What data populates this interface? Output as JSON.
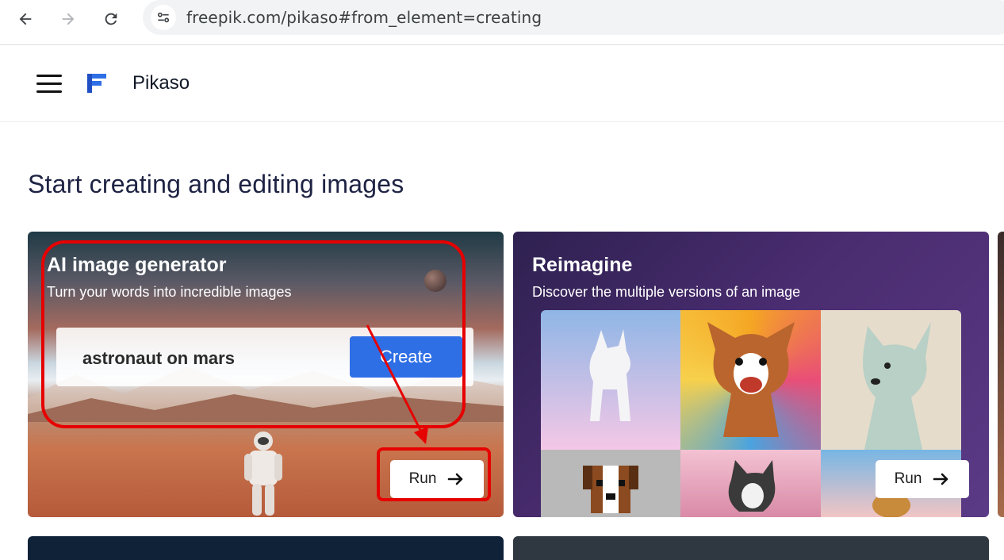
{
  "browser": {
    "url": "freepik.com/pikaso#from_element=creating"
  },
  "header": {
    "app_name": "Pikaso"
  },
  "page": {
    "title": "Start creating and editing images"
  },
  "cards": [
    {
      "title": "AI image generator",
      "subtitle": "Turn your words into incredible images",
      "prompt_value": "astronaut on mars",
      "create_label": "Create",
      "run_label": "Run"
    },
    {
      "title": "Reimagine",
      "subtitle": "Discover the multiple versions of an image",
      "run_label": "Run"
    }
  ],
  "colors": {
    "accent": "#2f6fe6",
    "annotation": "#e60000",
    "heading": "#1e2344"
  }
}
